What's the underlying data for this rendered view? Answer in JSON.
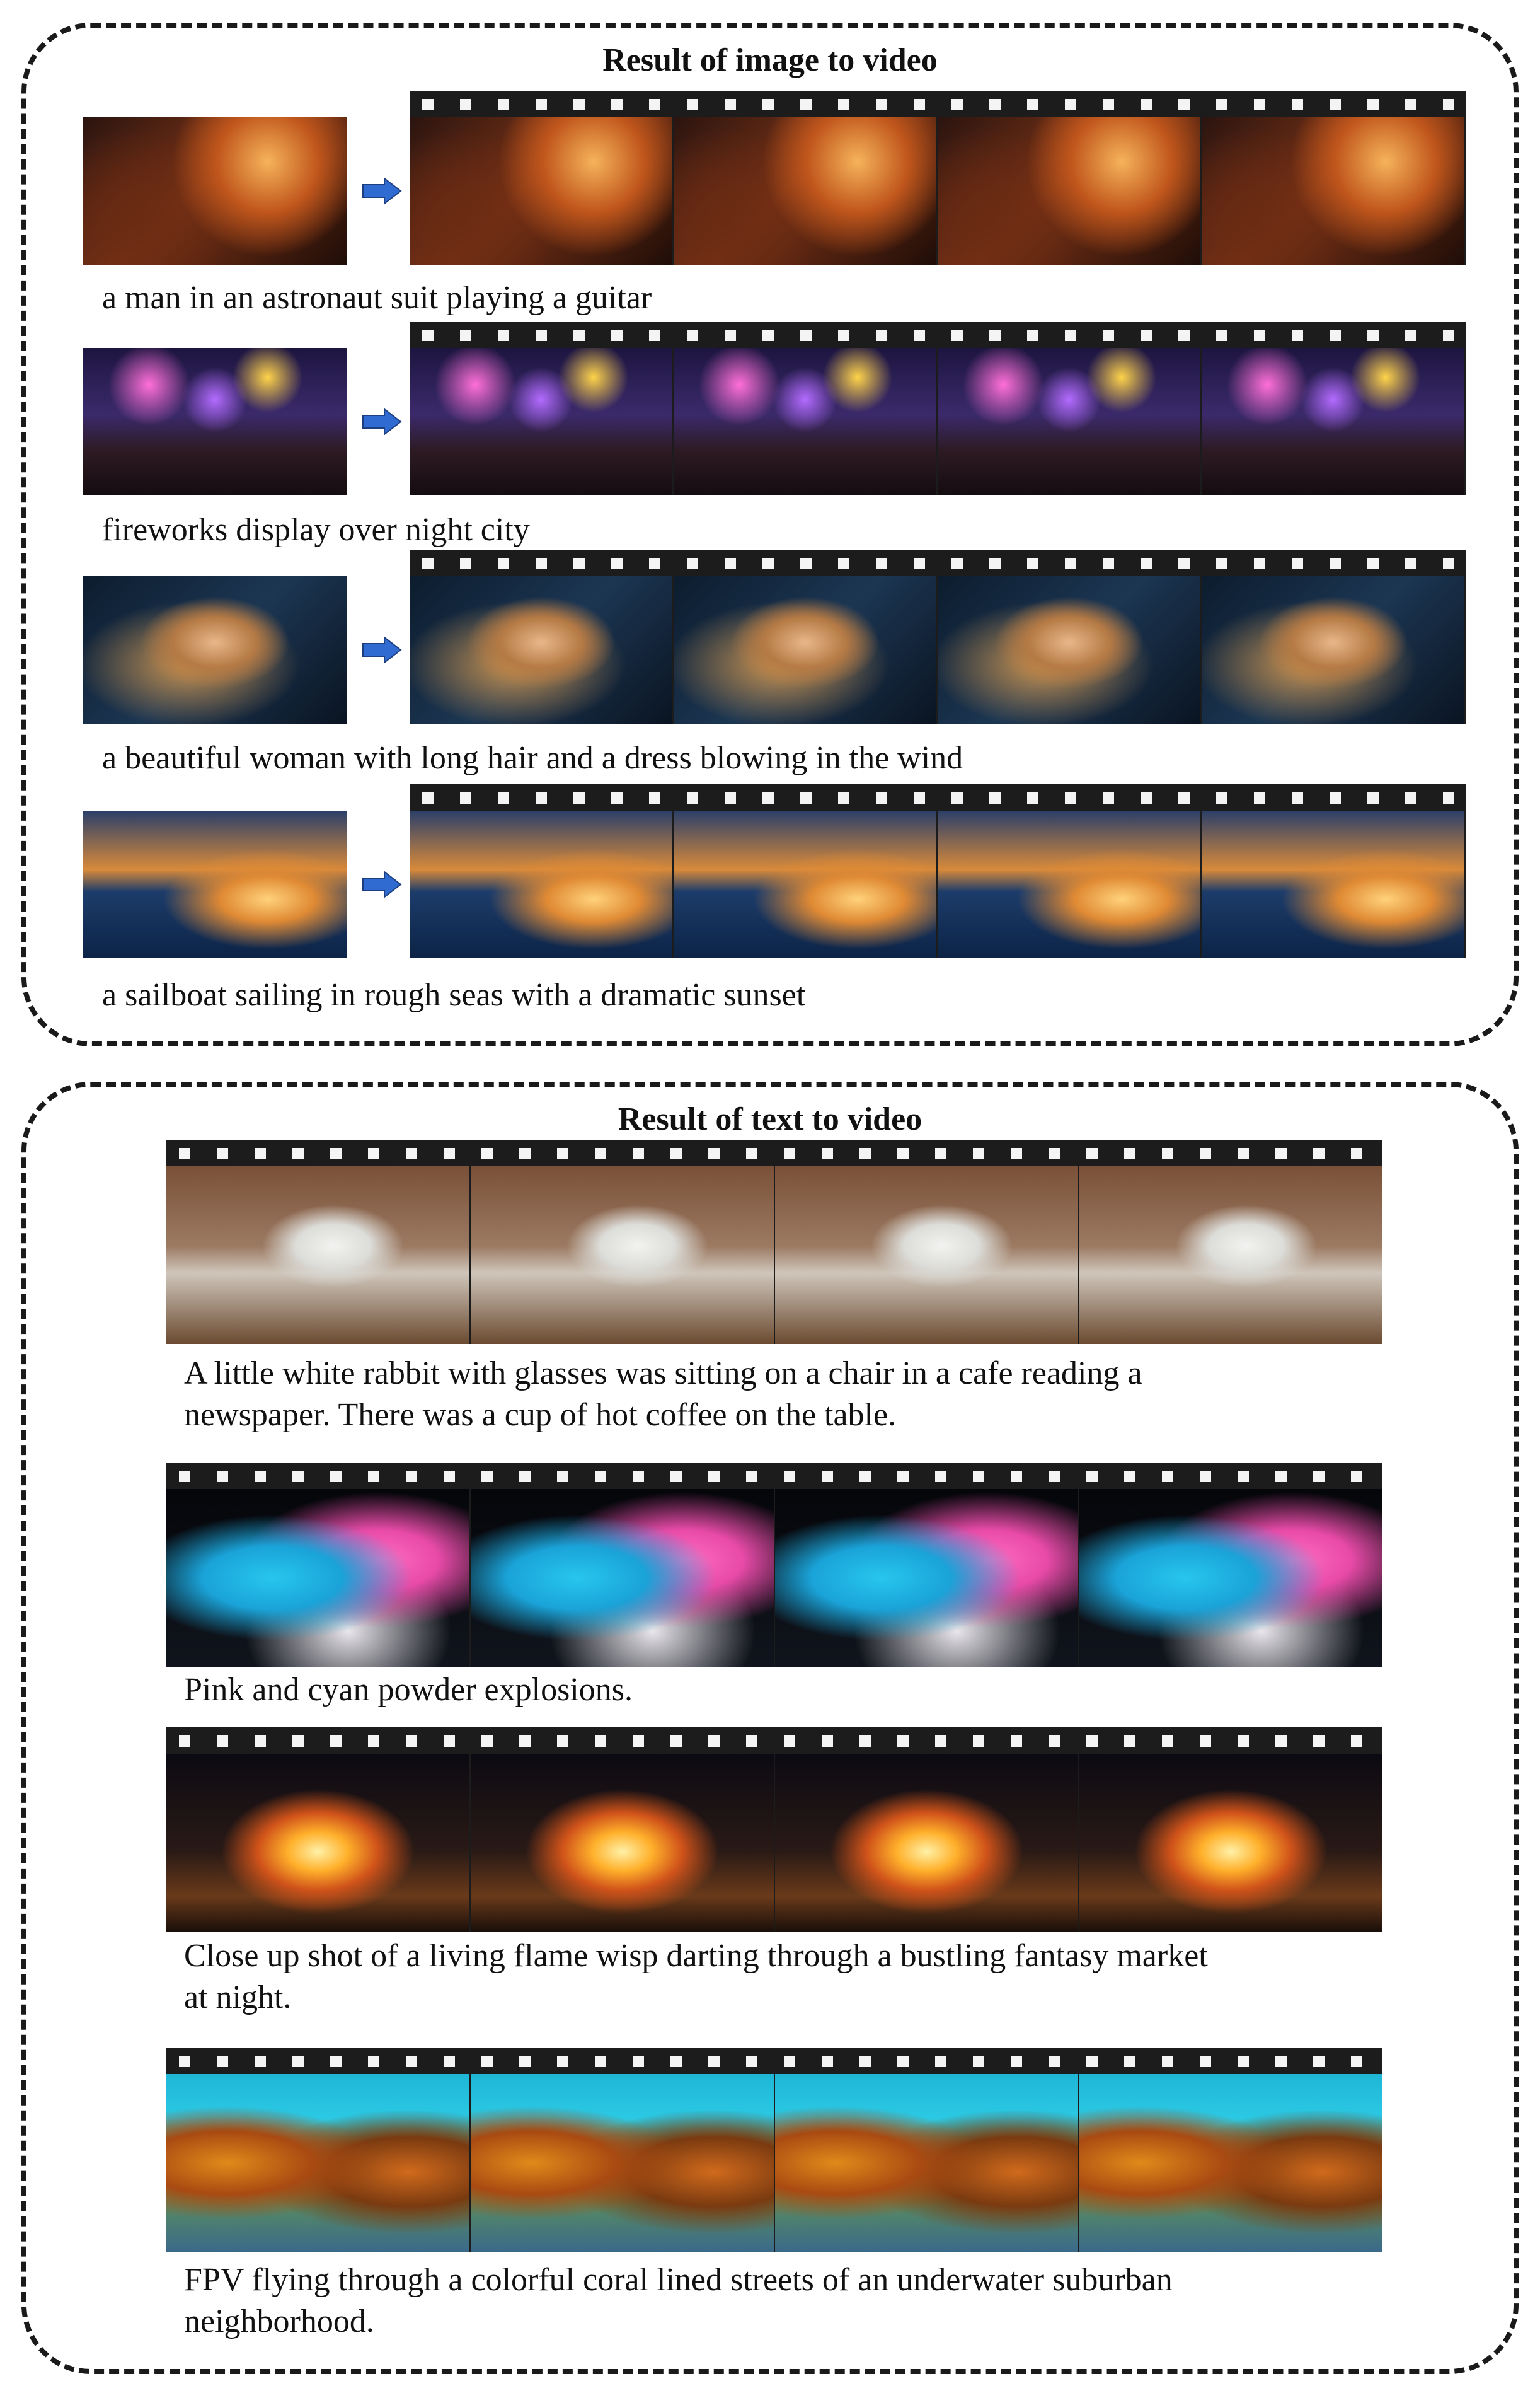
{
  "image_to_video": {
    "title": "Result of image to video",
    "rows": [
      {
        "caption": "a man in an astronaut suit playing a guitar",
        "scene": "astronaut"
      },
      {
        "caption": "fireworks display over night city",
        "scene": "fireworks"
      },
      {
        "caption": "a beautiful woman with long hair and a dress blowing in the wind",
        "scene": "woman"
      },
      {
        "caption": "a sailboat sailing in rough seas with a dramatic sunset",
        "scene": "sailboat"
      }
    ]
  },
  "text_to_video": {
    "title": "Result of text to video",
    "rows": [
      {
        "caption": "A little white rabbit with glasses was sitting on a chair in a cafe reading a\nnewspaper. There was a cup of hot coffee on the table.",
        "scene": "rabbit"
      },
      {
        "caption": "Pink and cyan powder explosions.",
        "scene": "powder"
      },
      {
        "caption": "Close up shot of a living flame wisp darting through a bustling fantasy market\nat night.",
        "scene": "flame"
      },
      {
        "caption": "FPV flying through a colorful coral lined streets of an underwater suburban\nneighborhood.",
        "scene": "coral"
      }
    ]
  },
  "colors": {
    "arrow": "#2f6bd0",
    "film": "#1c1c1c",
    "border": "#1a1a1a"
  }
}
